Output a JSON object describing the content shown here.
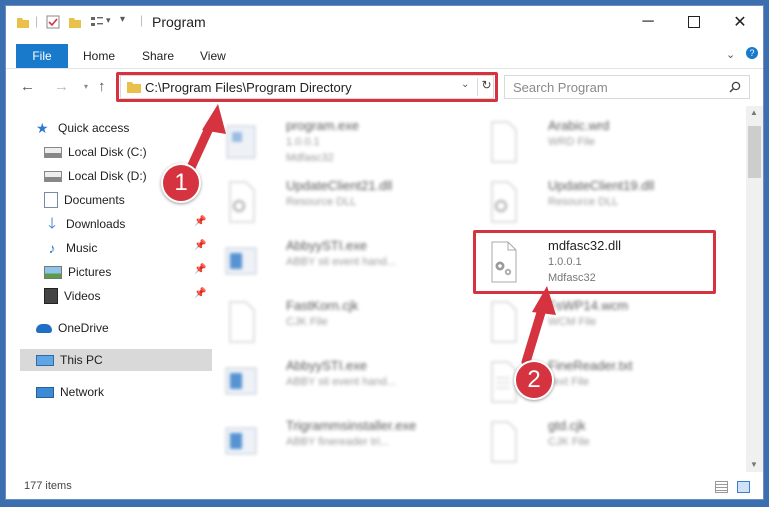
{
  "window": {
    "title": "Program"
  },
  "ribbon": {
    "tabs": [
      "File",
      "Home",
      "Share",
      "View"
    ]
  },
  "address": {
    "path": "C:\\Program Files\\Program Directory"
  },
  "search": {
    "placeholder": "Search Program"
  },
  "nav_pane": {
    "items": [
      {
        "label": "Quick access"
      },
      {
        "label": "Local Disk (C:)"
      },
      {
        "label": "Local Disk (D:)"
      },
      {
        "label": "Documents"
      },
      {
        "label": "Downloads"
      },
      {
        "label": "Music"
      },
      {
        "label": "Pictures"
      },
      {
        "label": "Videos"
      },
      {
        "label": "OneDrive"
      },
      {
        "label": "This PC"
      },
      {
        "label": "Network"
      }
    ]
  },
  "files": [
    {
      "name": "program.exe",
      "line2": "1.0.0.1",
      "line3": "Mdfasc32"
    },
    {
      "name": "Arabic.wrd",
      "line2": "WRD File",
      "line3": ""
    },
    {
      "name": "UpdateClient21.dll",
      "line2": "Resource DLL",
      "line3": ""
    },
    {
      "name": "UpdateClient19.dll",
      "line2": "Resource DLL",
      "line3": ""
    },
    {
      "name": "AbbyySTI.exe",
      "line2": "ABBY sti event hand...",
      "line3": ""
    },
    {
      "name": "mdfasc32.dll",
      "line2": "1.0.0.1",
      "line3": "Mdfasc32"
    },
    {
      "name": "FastKorn.cjk",
      "line2": "CJK File",
      "line3": ""
    },
    {
      "name": "FsWP14.wcm",
      "line2": "WCM File",
      "line3": ""
    },
    {
      "name": "AbbyySTI.exe",
      "line2": "ABBY sti event hand...",
      "line3": ""
    },
    {
      "name": "FineReader.txt",
      "line2": "Text File",
      "line3": ""
    },
    {
      "name": "Trigrammsinstaller.exe",
      "line2": "ABBY finereader tri...",
      "line3": ""
    },
    {
      "name": "gtd.cjk",
      "line2": "CJK File",
      "line3": ""
    }
  ],
  "status": {
    "item_count": "177 items"
  },
  "callouts": [
    "1",
    "2"
  ],
  "colors": {
    "accent": "#1979ca",
    "highlight": "#d4333f"
  }
}
